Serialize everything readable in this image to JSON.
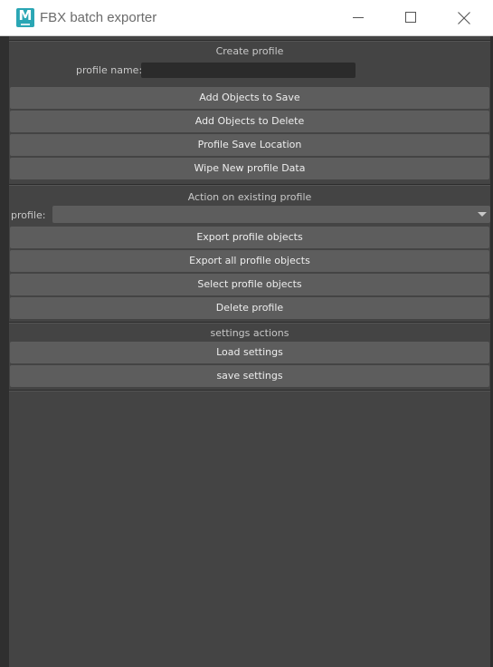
{
  "window": {
    "title": "FBX batch exporter",
    "icon": "maya-app-icon",
    "icon_letter": "M"
  },
  "create_profile": {
    "title": "Create profile",
    "name_label": "profile name:",
    "name_value": "",
    "buttons": [
      "Add Objects to Save",
      "Add Objects to Delete",
      "Profile Save Location",
      "Wipe New profile Data"
    ]
  },
  "existing_profile": {
    "title": "Action on existing profile",
    "profile_label": "profile:",
    "profile_value": "",
    "buttons": [
      "Export profile objects",
      "Export all profile objects",
      "Select profile objects",
      "Delete profile"
    ]
  },
  "settings": {
    "title": "settings actions",
    "buttons": [
      "Load settings",
      "save settings"
    ]
  },
  "colors": {
    "panel_bg": "#444444",
    "button_bg": "#5d5d5d",
    "field_bg": "#2b2b2b",
    "label_text": "#c8c8c8",
    "button_text": "#eeeeee",
    "icon_accent": "#2aa6b4"
  }
}
